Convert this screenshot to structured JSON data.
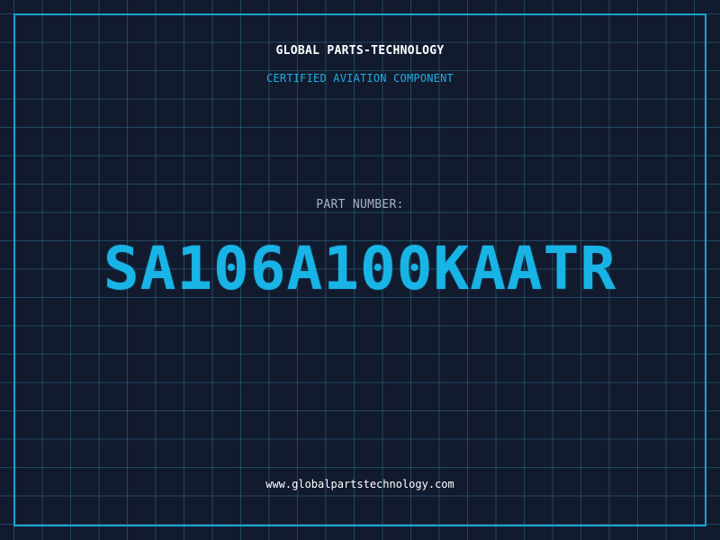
{
  "header": {
    "company_name": "GLOBAL PARTS-TECHNOLOGY",
    "tagline": "CERTIFIED AVIATION COMPONENT"
  },
  "part": {
    "label": "PART NUMBER:",
    "number": "SA106A100KAATR"
  },
  "footer": {
    "website": "www.globalpartstechnology.com"
  },
  "colors": {
    "background": "#121a2e",
    "grid": "#2e6e8c",
    "accent": "#19b4e6",
    "heading_text": "#ffffff",
    "label_text": "#a8b2c4"
  }
}
